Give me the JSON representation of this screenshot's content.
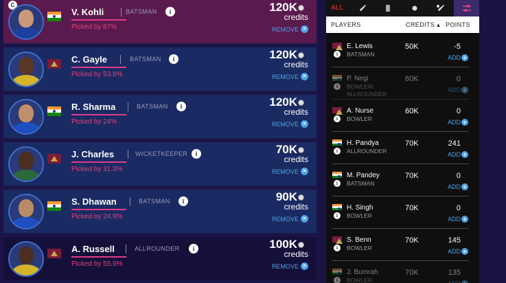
{
  "team": [
    {
      "name": "V. Kohli",
      "role": "BATSMAN",
      "flag": "india",
      "picked": "Picked by 87%",
      "credits": "120K",
      "credits_label": "credits",
      "remove": "REMOVE",
      "captain_badge": "C",
      "style": "captain",
      "skin": "#c99a7a",
      "shirt": "#1e3fa0"
    },
    {
      "name": "C. Gayle",
      "role": "BATSMAN",
      "flag": "west-indies",
      "picked": "Picked by 53.8%",
      "credits": "120K",
      "credits_label": "credits",
      "remove": "REMOVE",
      "style": "blue",
      "skin": "#5a3826",
      "shirt": "#d4b52a"
    },
    {
      "name": "R. Sharma",
      "role": "BATSMAN",
      "flag": "india",
      "picked": "Picked by 24%",
      "credits": "120K",
      "credits_label": "credits",
      "remove": "REMOVE",
      "style": "blue",
      "skin": "#c18e6c",
      "shirt": "#1e4fc0"
    },
    {
      "name": "J. Charles",
      "role": "WICKETKEEPER",
      "flag": "west-indies",
      "picked": "Picked by 31.3%",
      "credits": "70K",
      "credits_label": "credits",
      "remove": "REMOVE",
      "style": "blue",
      "skin": "#4a2e20",
      "shirt": "#2a6a3a"
    },
    {
      "name": "S. Dhawan",
      "role": "BATSMAN",
      "flag": "india",
      "picked": "Picked by 24.9%",
      "credits": "90K",
      "credits_label": "credits",
      "remove": "REMOVE",
      "style": "blue",
      "skin": "#b88a68",
      "shirt": "#1e4fc0"
    },
    {
      "name": "A. Russell",
      "role": "ALLROUNDER",
      "flag": "west-indies",
      "picked": "Picked by 55.9%",
      "credits": "100K",
      "credits_label": "credits",
      "remove": "REMOVE",
      "style": "dark",
      "skin": "#4a2e20",
      "shirt": "#d4b52a"
    }
  ],
  "filters": {
    "all_label": "ALL",
    "icons": [
      "bat-icon",
      "wicketkeeper-icon",
      "ball-icon",
      "allrounder-icon",
      "filter-icon"
    ]
  },
  "table_head": {
    "players": "PLAYERS",
    "credits": "CREDITS",
    "points": "POINTS"
  },
  "pool": [
    {
      "name": "E. Lewis",
      "role": "BATSMAN",
      "flag": "west-indies",
      "credits": "50K",
      "points": "-5",
      "add": "ADD",
      "faded": false
    },
    {
      "name": "P. Negi",
      "role": "BOWLER/ ALLROUNDER",
      "flag": "india",
      "credits": "60K",
      "points": "0",
      "add": "ADD",
      "faded": true
    },
    {
      "name": "A. Nurse",
      "role": "BOWLER",
      "flag": "west-indies",
      "credits": "60K",
      "points": "0",
      "add": "ADD",
      "faded": false
    },
    {
      "name": "H. Pandya",
      "role": "ALLROUNDER",
      "flag": "india",
      "credits": "70K",
      "points": "241",
      "add": "ADD",
      "faded": false
    },
    {
      "name": "M. Pandey",
      "role": "BATSMAN",
      "flag": "india",
      "credits": "70K",
      "points": "0",
      "add": "ADD",
      "faded": false
    },
    {
      "name": "H. Singh",
      "role": "BOWLER",
      "flag": "india",
      "credits": "70K",
      "points": "0",
      "add": "ADD",
      "faded": false
    },
    {
      "name": "S. Benn",
      "role": "BOWLER",
      "flag": "west-indies",
      "credits": "70K",
      "points": "145",
      "add": "ADD",
      "faded": false
    },
    {
      "name": "J. Bumrah",
      "role": "BOWLER",
      "flag": "india",
      "credits": "70K",
      "points": "135",
      "add": "ADD",
      "faded": true
    }
  ],
  "colors": {
    "accent": "#e23b8a",
    "link": "#4da3e6",
    "active_tab": "#e23b3b"
  }
}
